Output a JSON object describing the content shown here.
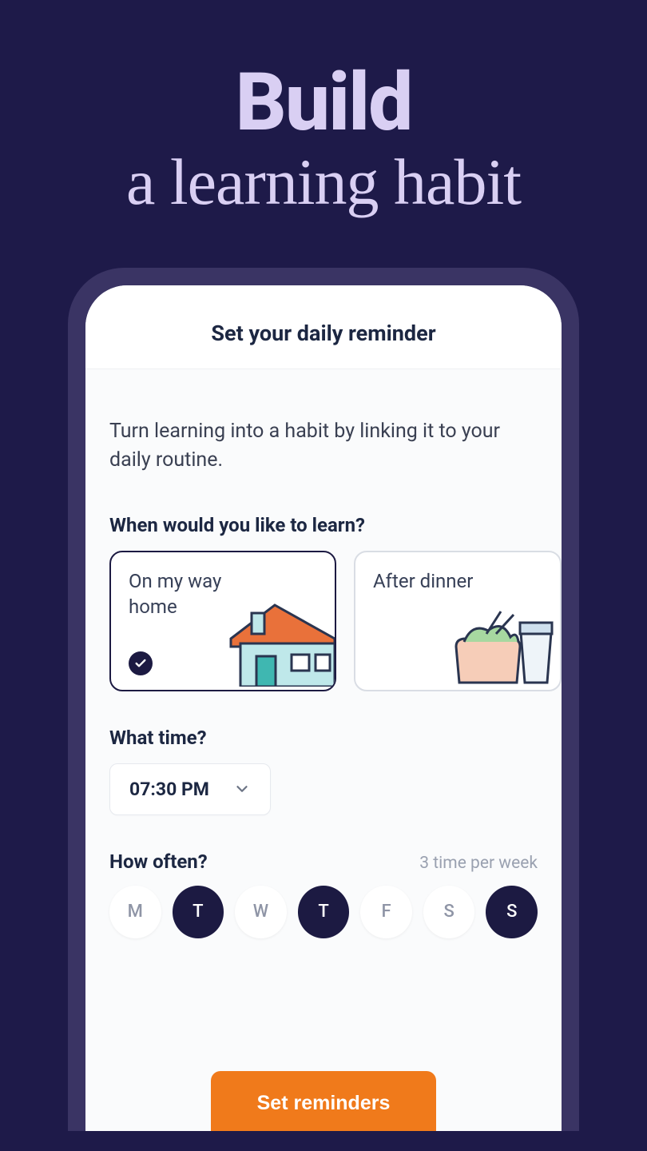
{
  "hero": {
    "line1": "Build",
    "line2": "a learning habit"
  },
  "screen": {
    "title": "Set your daily reminder",
    "intro": "Turn learning into a habit by linking it to your daily routine.",
    "when": {
      "label": "When would you like to learn?",
      "options": [
        {
          "label": "On my way home",
          "selected": true
        },
        {
          "label": "After dinner",
          "selected": false
        }
      ]
    },
    "time": {
      "label": "What time?",
      "value": "07:30 PM"
    },
    "frequency": {
      "label": "How often?",
      "summary": "3 time per week",
      "days": [
        {
          "letter": "M",
          "active": false
        },
        {
          "letter": "T",
          "active": true
        },
        {
          "letter": "W",
          "active": false
        },
        {
          "letter": "T",
          "active": true
        },
        {
          "letter": "F",
          "active": false
        },
        {
          "letter": "S",
          "active": false
        },
        {
          "letter": "S",
          "active": true
        }
      ]
    },
    "cta": "Set reminders"
  },
  "icons": {
    "check": "check-icon",
    "chevron_down": "chevron-down-icon",
    "house": "house-icon",
    "dinner": "dinner-icon"
  }
}
